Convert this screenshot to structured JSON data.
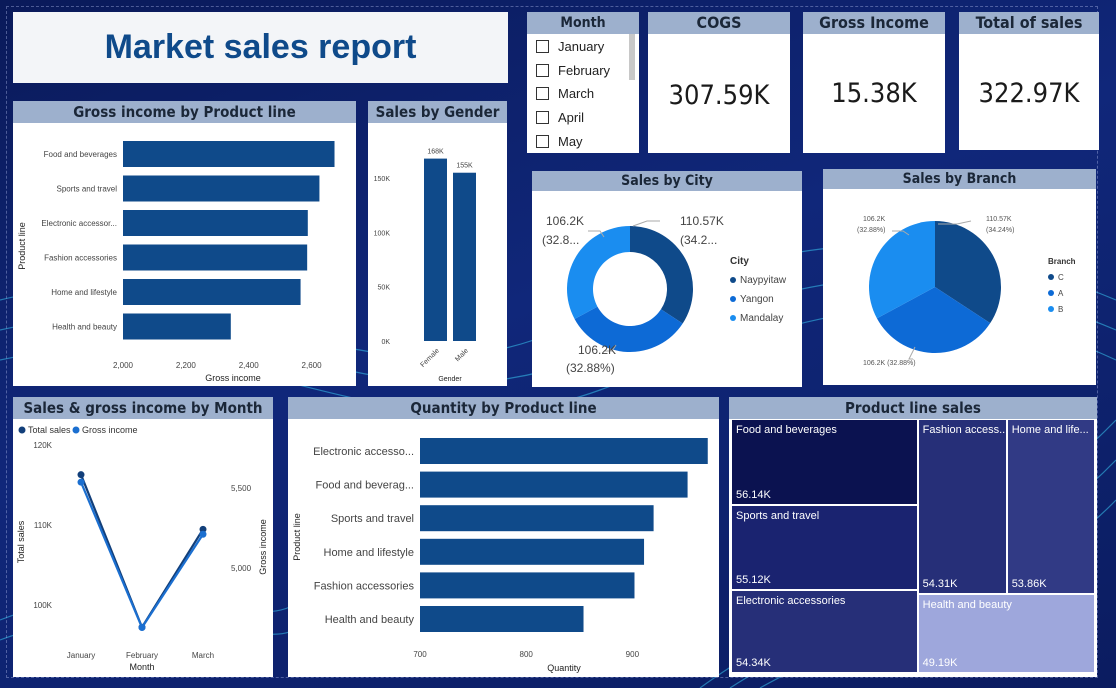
{
  "report": {
    "title": "Market sales report"
  },
  "month_slicer": {
    "title": "Month",
    "options": [
      "January",
      "February",
      "March",
      "April",
      "May"
    ]
  },
  "kpis": [
    {
      "title": "COGS",
      "value": "307.59K"
    },
    {
      "title": "Gross Income",
      "value": "15.38K"
    },
    {
      "title": "Total of sales",
      "value": "322.97K"
    }
  ],
  "colors": {
    "dark_blue": "#0f4a8a",
    "mid_blue": "#0d6ad6",
    "light_blue": "#1a8df0",
    "panel_title_bg": "#9db0cd"
  },
  "chart_data": [
    {
      "id": "gross-income-by-product",
      "type": "bar",
      "orientation": "horizontal",
      "title": "Gross income by Product line",
      "xlabel": "Gross income",
      "ylabel": "Product line",
      "categories": [
        "Food and beverages",
        "Sports and travel",
        "Electronic accessor...",
        "Fashion accessories",
        "Home and lifestyle",
        "Health and beauty"
      ],
      "values": [
        2673,
        2625,
        2588,
        2586,
        2565,
        2343
      ],
      "xlim": [
        2000,
        2700
      ],
      "xticks": [
        2000,
        2200,
        2400,
        2600
      ],
      "xtick_labels": [
        "2,000",
        "2,200",
        "2,400",
        "2,600"
      ],
      "grid": false
    },
    {
      "id": "sales-by-gender",
      "type": "bar",
      "title": "Sales by Gender",
      "xlabel": "Gender",
      "categories": [
        "Female",
        "Male"
      ],
      "values": [
        168,
        155
      ],
      "data_labels": [
        "168K",
        "155K"
      ],
      "ylim": [
        0,
        175
      ],
      "yticks": [
        0,
        50,
        100,
        150
      ],
      "ytick_labels": [
        "0K",
        "50K",
        "100K",
        "150K"
      ]
    },
    {
      "id": "sales-by-city",
      "type": "pie",
      "variant": "donut",
      "title": "Sales by City",
      "legend_title": "City",
      "legend_position": "right",
      "categories": [
        "Naypyitaw",
        "Yangon",
        "Mandalay"
      ],
      "values": [
        110.57,
        106.2,
        106.2
      ],
      "data_labels": [
        [
          "110.57K",
          "(34.2..."
        ],
        [
          "106.2K",
          "(32.88%)"
        ],
        [
          "106.2K",
          "(32.8..."
        ]
      ],
      "colors": [
        "#0f4a8a",
        "#0d6ad6",
        "#1a8df0"
      ]
    },
    {
      "id": "sales-by-branch",
      "type": "pie",
      "title": "Sales by Branch",
      "legend_title": "Branch",
      "legend_position": "right",
      "categories": [
        "C",
        "A",
        "B"
      ],
      "values": [
        110.57,
        106.2,
        106.2
      ],
      "data_labels": [
        [
          "110.57K",
          "(34.24%)"
        ],
        [
          "106.2K (32.88%)"
        ],
        [
          "106.2K",
          "(32.88%)"
        ]
      ],
      "colors": [
        "#0f4a8a",
        "#0d6ad6",
        "#1a8df0"
      ]
    },
    {
      "id": "sales-gross-income-by-month",
      "type": "line",
      "title": "Sales & gross income by Month",
      "xlabel": "Month",
      "ylabel": "Total sales",
      "y2label": "Gross income",
      "categories": [
        "January",
        "February",
        "March"
      ],
      "legend_position": "top-left",
      "series": [
        {
          "name": "Total sales",
          "axis": "left",
          "values": [
            116.29,
            97.22,
            109.46
          ],
          "color": "#123f7a"
        },
        {
          "name": "Gross income",
          "axis": "right",
          "values": [
            5537.7,
            4629.5,
            5212.2
          ],
          "color": "#1b6fd0"
        }
      ],
      "ylim": [
        95,
        121
      ],
      "yticks": [
        100,
        110,
        120
      ],
      "ytick_labels": [
        "100K",
        "110K",
        "120K"
      ],
      "y2lim": [
        4520,
        5820
      ],
      "y2ticks": [
        5000,
        5500
      ],
      "y2tick_labels": [
        "5,000",
        "5,500"
      ]
    },
    {
      "id": "quantity-by-product",
      "type": "bar",
      "orientation": "horizontal",
      "title": "Quantity by Product line",
      "xlabel": "Quantity",
      "ylabel": "Product line",
      "categories": [
        "Electronic accesso...",
        "Food and beverag...",
        "Sports and travel",
        "Home and lifestyle",
        "Fashion accessories",
        "Health and beauty"
      ],
      "values": [
        971,
        952,
        920,
        911,
        902,
        854
      ],
      "xlim": [
        700,
        975
      ],
      "xticks": [
        700,
        800,
        900
      ],
      "xtick_labels": [
        "700",
        "800",
        "900"
      ]
    },
    {
      "id": "product-line-sales",
      "type": "treemap",
      "title": "Product line sales",
      "categories": [
        "Food and beverages",
        "Sports and travel",
        "Electronic accessories",
        "Fashion access...",
        "Home and life...",
        "Health and beauty"
      ],
      "values": [
        56.14,
        55.12,
        54.34,
        54.31,
        53.86,
        49.19
      ],
      "data_labels": [
        "56.14K",
        "55.12K",
        "54.34K",
        "54.31K",
        "53.86K",
        "49.19K"
      ],
      "colors": [
        "#0b1250",
        "#1a2370",
        "#262f78",
        "#262f78",
        "#313a85",
        "#9ea7dc"
      ]
    }
  ]
}
